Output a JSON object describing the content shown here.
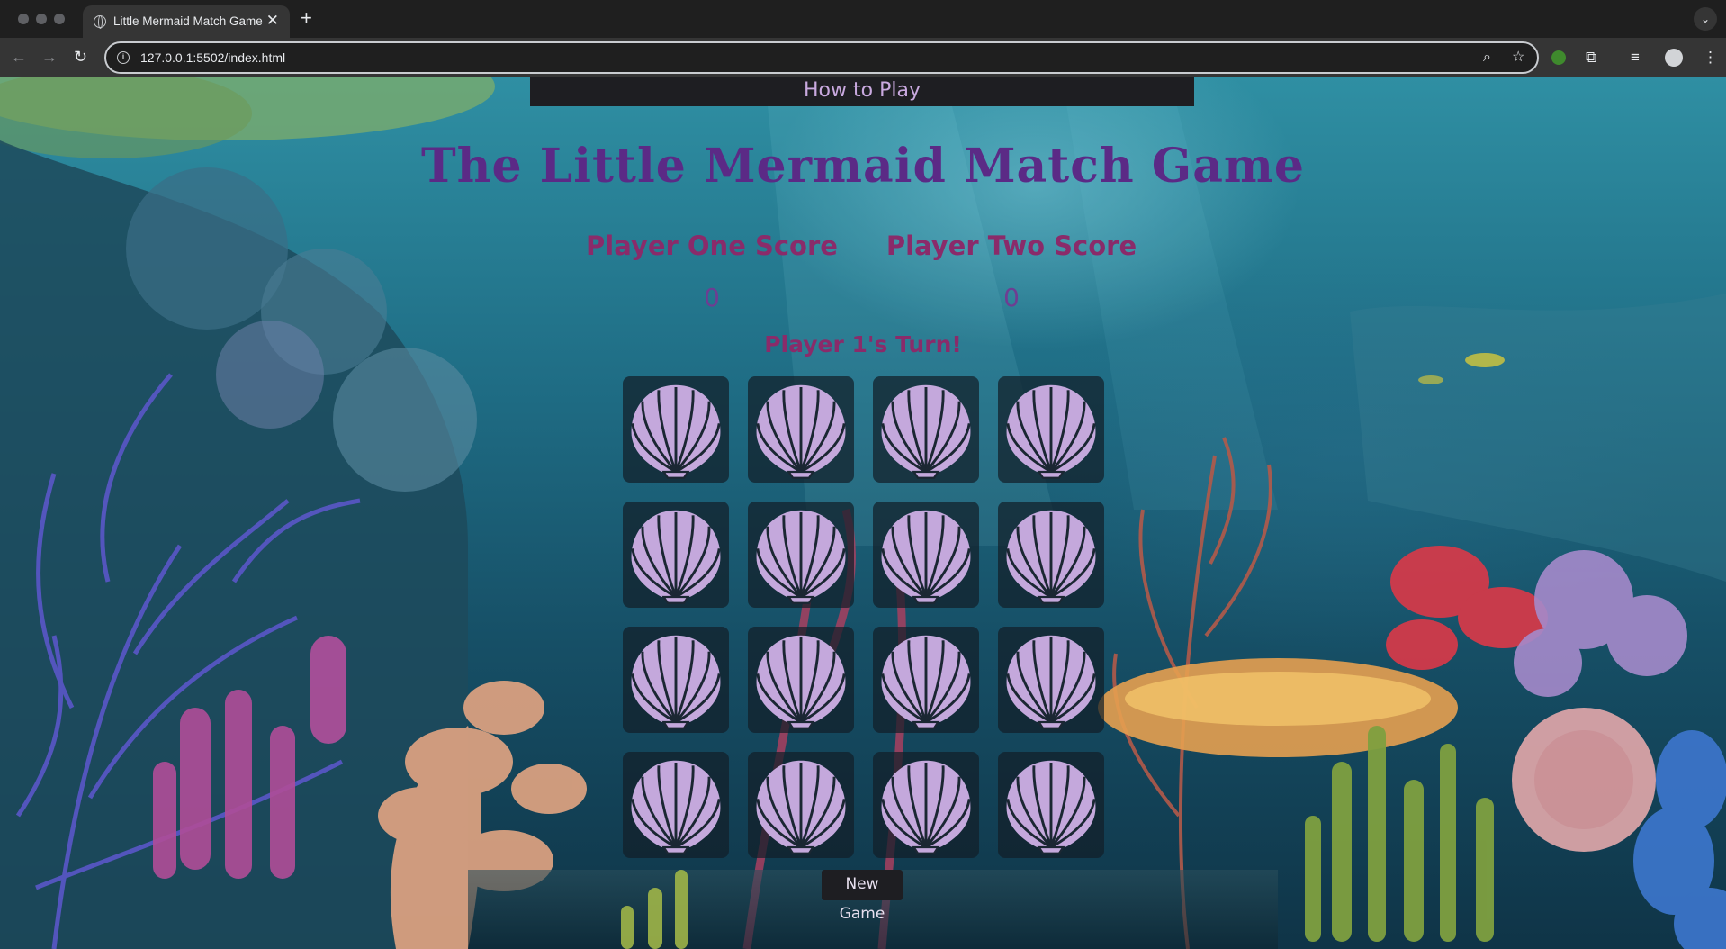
{
  "browser": {
    "tab_title": "Little Mermaid Match Game",
    "tab_close": "✕",
    "new_tab": "+",
    "url": "127.0.0.1:5502/index.html"
  },
  "page": {
    "how_to_play": "How to Play",
    "title": "The Little Mermaid Match Game",
    "players": [
      {
        "label": "Player One Score",
        "score": "0"
      },
      {
        "label": "Player Two Score",
        "score": "0"
      }
    ],
    "turn_text": "Player 1's Turn!",
    "cards": [
      {
        "state": "face-down",
        "icon": "seashell-icon"
      },
      {
        "state": "face-down",
        "icon": "seashell-icon"
      },
      {
        "state": "face-down",
        "icon": "seashell-icon"
      },
      {
        "state": "face-down",
        "icon": "seashell-icon"
      },
      {
        "state": "face-down",
        "icon": "seashell-icon"
      },
      {
        "state": "face-down",
        "icon": "seashell-icon"
      },
      {
        "state": "face-down",
        "icon": "seashell-icon"
      },
      {
        "state": "face-down",
        "icon": "seashell-icon"
      },
      {
        "state": "face-down",
        "icon": "seashell-icon"
      },
      {
        "state": "face-down",
        "icon": "seashell-icon"
      },
      {
        "state": "face-down",
        "icon": "seashell-icon"
      },
      {
        "state": "face-down",
        "icon": "seashell-icon"
      },
      {
        "state": "face-down",
        "icon": "seashell-icon"
      },
      {
        "state": "face-down",
        "icon": "seashell-icon"
      },
      {
        "state": "face-down",
        "icon": "seashell-icon"
      },
      {
        "state": "face-down",
        "icon": "seashell-icon"
      }
    ],
    "new_game": "New Game"
  },
  "colors": {
    "title": "#5b2a86",
    "score_label": "#8a2b6a",
    "shell": "#c4a8dc",
    "card_back": "#121e28"
  }
}
